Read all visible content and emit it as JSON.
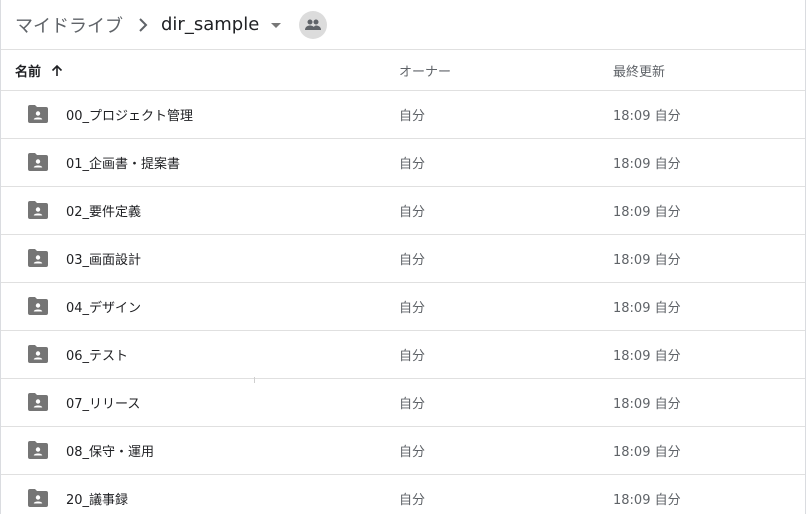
{
  "breadcrumb": {
    "root": "マイドライブ",
    "current": "dir_sample"
  },
  "icons": {
    "separator": "chevron-right-icon",
    "dropdown": "caret-down-icon",
    "shared": "people-icon",
    "sort": "arrow-up-icon",
    "folder": "shared-folder-icon"
  },
  "columns": {
    "name": "名前",
    "owner": "オーナー",
    "modified": "最終更新"
  },
  "files": [
    {
      "name": "00_プロジェクト管理",
      "owner": "自分",
      "modified": "18:09 自分"
    },
    {
      "name": "01_企画書・提案書",
      "owner": "自分",
      "modified": "18:09 自分"
    },
    {
      "name": "02_要件定義",
      "owner": "自分",
      "modified": "18:09 自分"
    },
    {
      "name": "03_画面設計",
      "owner": "自分",
      "modified": "18:09 自分"
    },
    {
      "name": "04_デザイン",
      "owner": "自分",
      "modified": "18:09 自分"
    },
    {
      "name": "06_テスト",
      "owner": "自分",
      "modified": "18:09 自分"
    },
    {
      "name": "07_リリース",
      "owner": "自分",
      "modified": "18:09 自分"
    },
    {
      "name": "08_保守・運用",
      "owner": "自分",
      "modified": "18:09 自分"
    },
    {
      "name": "20_議事録",
      "owner": "自分",
      "modified": "18:09 自分"
    }
  ],
  "colors": {
    "folder": "#757575",
    "divider": "#e0e0e0",
    "text_primary": "#202124",
    "text_secondary": "#5f6368"
  }
}
